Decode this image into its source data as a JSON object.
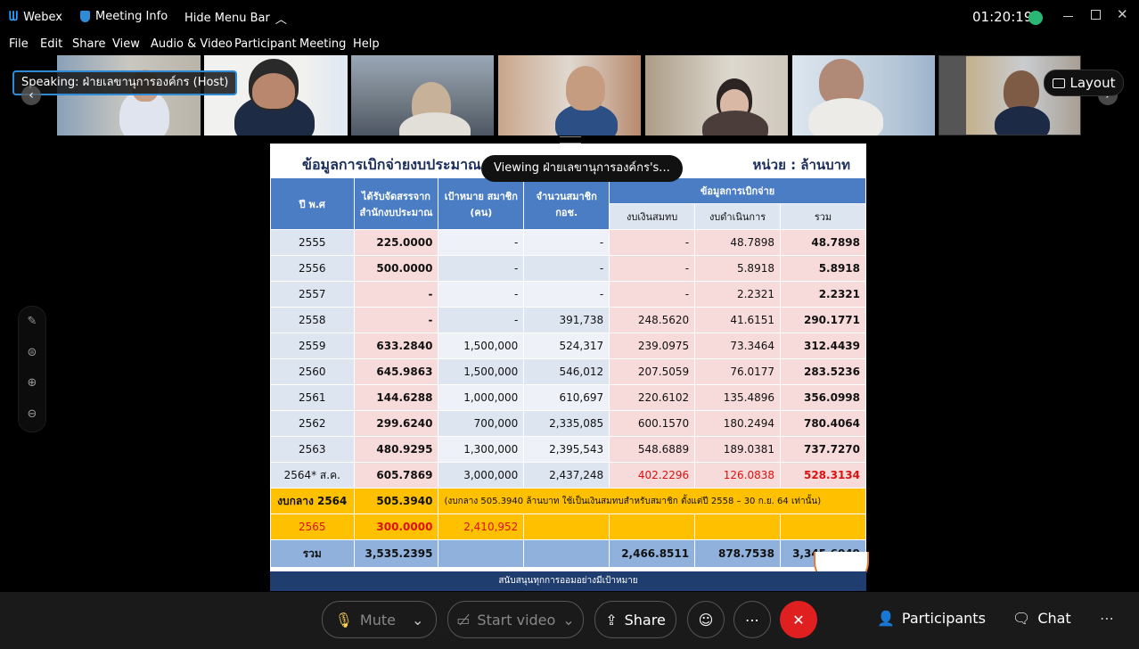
{
  "app": {
    "name": "Webex",
    "meeting_info": "Meeting Info",
    "hide_menu": "Hide Menu Bar",
    "clock": "01:20:19"
  },
  "menu": [
    "File",
    "Edit",
    "Share",
    "View",
    "Audio & Video",
    "Participant",
    "Meeting",
    "Help"
  ],
  "speaking": "Speaking: ฝ่ายเลขานุการองค์กร (Host)",
  "layout_label": "Layout",
  "viewing": "Viewing ฝ่ายเลขานุการองค์กร's...",
  "slide": {
    "title": "ข้อมูลการเบิกจ่ายงบประมาณ ขอ",
    "unit": "หน่วย : ล้านบาท",
    "headers": {
      "year": "ปี พ.ศ",
      "alloc": "ได้รับจัดสรรจาก สำนักงบประมาณ",
      "target": "เป้าหมาย สมาชิก (คน)",
      "members": "จำนวนสมาชิก กอช.",
      "disb": "ข้อมูลการเบิกจ่าย",
      "contrib": "งบเงินสมทบ",
      "ops": "งบดำเนินการ",
      "sum": "รวม"
    },
    "rows": [
      {
        "year": "2555",
        "alloc": "225.0000",
        "target": "-",
        "members": "-",
        "contrib": "-",
        "ops": "48.7898",
        "sum": "48.7898"
      },
      {
        "year": "2556",
        "alloc": "500.0000",
        "target": "-",
        "members": "-",
        "contrib": "-",
        "ops": "5.8918",
        "sum": "5.8918"
      },
      {
        "year": "2557",
        "alloc": "-",
        "target": "-",
        "members": "-",
        "contrib": "-",
        "ops": "2.2321",
        "sum": "2.2321"
      },
      {
        "year": "2558",
        "alloc": "-",
        "target": "-",
        "members": "391,738",
        "contrib": "248.5620",
        "ops": "41.6151",
        "sum": "290.1771"
      },
      {
        "year": "2559",
        "alloc": "633.2840",
        "target": "1,500,000",
        "members": "524,317",
        "contrib": "239.0975",
        "ops": "73.3464",
        "sum": "312.4439"
      },
      {
        "year": "2560",
        "alloc": "645.9863",
        "target": "1,500,000",
        "members": "546,012",
        "contrib": "207.5059",
        "ops": "76.0177",
        "sum": "283.5236"
      },
      {
        "year": "2561",
        "alloc": "144.6288",
        "target": "1,000,000",
        "members": "610,697",
        "contrib": "220.6102",
        "ops": "135.4896",
        "sum": "356.0998"
      },
      {
        "year": "2562",
        "alloc": "299.6240",
        "target": "700,000",
        "members": "2,335,085",
        "contrib": "600.1570",
        "ops": "180.2494",
        "sum": "780.4064"
      },
      {
        "year": "2563",
        "alloc": "480.9295",
        "target": "1,300,000",
        "members": "2,395,543",
        "contrib": "548.6889",
        "ops": "189.0381",
        "sum": "737.7270"
      },
      {
        "year": "2564* ส.ค.",
        "alloc": "605.7869",
        "target": "3,000,000",
        "members": "2,437,248",
        "contrib": "402.2296",
        "ops": "126.0838",
        "sum": "528.3134"
      }
    ],
    "central": {
      "year": "งบกลาง 2564",
      "alloc": "505.3940",
      "note": "(งบกลาง 505.3940 ล้านบาท ใช้เป็นเงินสมทบสำหรับสมาชิก ตั้งแต่ปี 2558 – 30 ก.ย. 64 เท่านั้น)"
    },
    "next": {
      "year": "2565",
      "alloc": "300.0000",
      "target": "2,410,952"
    },
    "total": {
      "year": "รวม",
      "alloc": "3,535.2395",
      "contrib": "2,466.8511",
      "ops": "878.7538",
      "sum": "3,345.6049"
    },
    "footer": "สนับสนุนทุกการออมอย่างมีเป้าหมาย"
  },
  "controls": {
    "mute": "Mute",
    "start_video": "Start video",
    "share": "Share",
    "participants": "Participants",
    "chat": "Chat"
  }
}
